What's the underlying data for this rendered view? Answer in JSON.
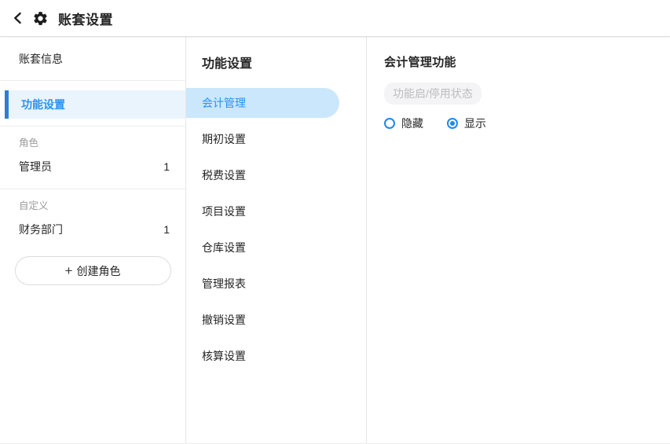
{
  "header": {
    "title": "账套设置"
  },
  "sidebar": {
    "nav_items": [
      {
        "label": "账套信息",
        "selected": false
      },
      {
        "label": "功能设置",
        "selected": true
      }
    ],
    "sections": [
      {
        "title": "角色",
        "rows": [
          {
            "label": "管理员",
            "count": "1"
          }
        ]
      },
      {
        "title": "自定义",
        "rows": [
          {
            "label": "财务部门",
            "count": "1"
          }
        ]
      }
    ],
    "create_role": {
      "icon": "+",
      "label": "创建角色"
    }
  },
  "function_panel": {
    "title": "功能设置",
    "items": [
      "会计管理",
      "期初设置",
      "税费设置",
      "项目设置",
      "仓库设置",
      "管理报表",
      "撤销设置",
      "核算设置"
    ],
    "selected_index": 0
  },
  "detail_panel": {
    "title": "会计管理功能",
    "status_badge": "功能启/停用状态",
    "radios": [
      {
        "label": "隐藏",
        "checked": false
      },
      {
        "label": "显示",
        "checked": true
      }
    ]
  },
  "colors": {
    "accent_text": "#2b92f0",
    "selected_pill_bg": "#cbe7fb",
    "sidebar_selected_bg": "#eaf4fd",
    "sidebar_selected_bar": "#2b7fd9",
    "radio_blue": "#2188e8",
    "badge_bg": "#f4f4f6",
    "badge_text": "#bdbdc1",
    "divider": "#e7e7e7"
  }
}
